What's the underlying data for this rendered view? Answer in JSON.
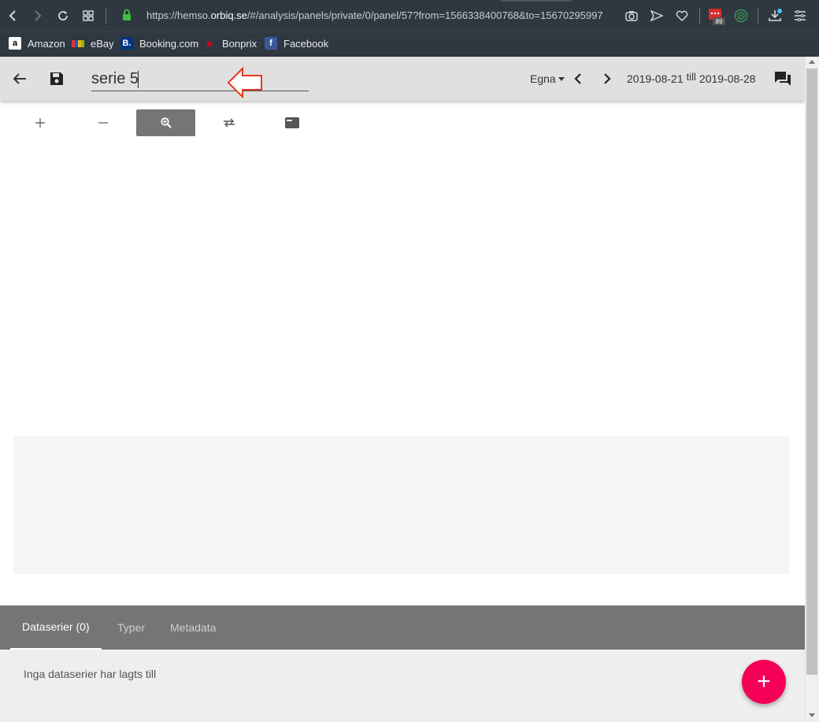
{
  "browser": {
    "url_prefix": "https://hemso.",
    "url_domain": "orbiq.se",
    "url_rest": "/#/analysis/panels/private/0/panel/57?from=1566338400768&to=15670295997",
    "notification_count": "89",
    "bookmarks": [
      {
        "label": "Amazon",
        "icon": "amazon-icon"
      },
      {
        "label": "eBay",
        "icon": "ebay-icon"
      },
      {
        "label": "Booking.com",
        "icon": "booking-icon"
      },
      {
        "label": "Bonprix",
        "icon": "bonprix-icon"
      },
      {
        "label": "Facebook",
        "icon": "facebook-icon"
      }
    ]
  },
  "header": {
    "title_value": "serie 5",
    "filter_label": "Egna",
    "date_from": "2019-08-21",
    "date_sep": "till",
    "date_to": "2019-08-28"
  },
  "toolbar": {
    "buttons": [
      {
        "name": "zoom-in",
        "glyph": "+"
      },
      {
        "name": "zoom-out",
        "glyph": "—"
      },
      {
        "name": "zoom-select",
        "glyph": "🔍",
        "active": true
      },
      {
        "name": "swap",
        "glyph": "⇄"
      },
      {
        "name": "legend",
        "glyph": "▬"
      }
    ]
  },
  "tabs": [
    {
      "label": "Dataserier (0)",
      "active": true
    },
    {
      "label": "Typer"
    },
    {
      "label": "Metadata"
    }
  ],
  "panel": {
    "empty_text": "Inga dataserier har lagts till",
    "fab_label": "+"
  },
  "colors": {
    "accent": "#f50057",
    "header_bg": "#e0e0e0",
    "tabs_bg": "#757575",
    "browser_bg": "#2f3740"
  }
}
